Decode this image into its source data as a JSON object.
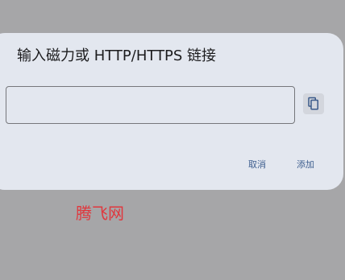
{
  "dialog": {
    "title": "输入磁力或 HTTP/HTTPS 链接",
    "input": {
      "value": "",
      "placeholder": ""
    },
    "paste_icon": "content-paste-icon",
    "cancel_label": "取消",
    "add_label": "添加"
  },
  "watermark": "腾飞网",
  "colors": {
    "backdrop": "#a6a6a8",
    "dialog_bg": "#e3e7ef",
    "action_text": "#3f5f8f",
    "watermark_text": "#e0373d"
  }
}
